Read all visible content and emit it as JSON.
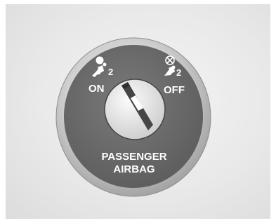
{
  "switch": {
    "on_label": "ON",
    "off_label": "OFF",
    "caption_line1": "PASSENGER",
    "caption_line2": "AIRBAG",
    "seat_number_on": "2",
    "seat_number_off": "2",
    "on_icon": "passenger-airbag-on-icon",
    "off_icon": "passenger-airbag-off-icon",
    "key_state": "pointing-to-on"
  },
  "colors": {
    "background": "#e6e6e6",
    "bezel": "#d0d0d0",
    "face": "#6b6b6b",
    "label": "#ffffff"
  }
}
